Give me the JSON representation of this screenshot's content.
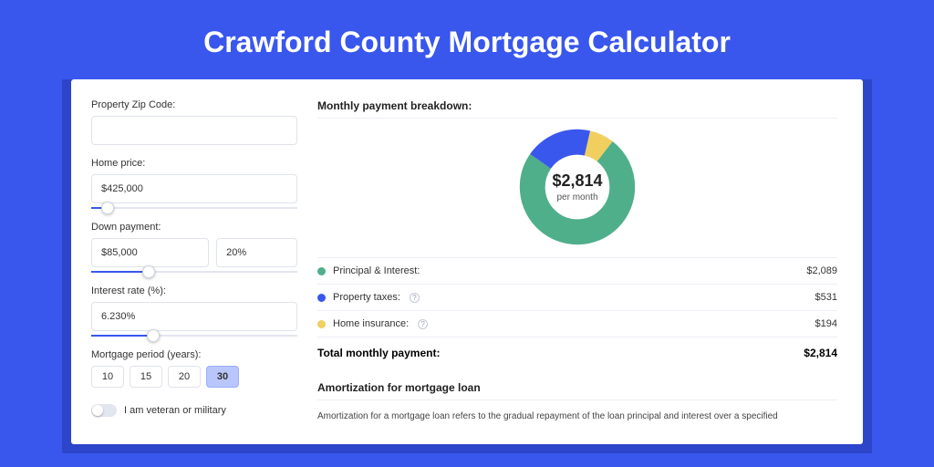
{
  "title": "Crawford County Mortgage Calculator",
  "left": {
    "zip_label": "Property Zip Code:",
    "zip_value": "",
    "price_label": "Home price:",
    "price_value": "$425,000",
    "price_fill_pct": 8,
    "down_label": "Down payment:",
    "down_value": "$85,000",
    "down_pct": "20%",
    "down_fill_pct": 28,
    "rate_label": "Interest rate (%):",
    "rate_value": "6.230%",
    "rate_fill_pct": 30,
    "period_label": "Mortgage period (years):",
    "periods": [
      "10",
      "15",
      "20",
      "30"
    ],
    "period_selected": "30",
    "vet_label": "I am veteran or military"
  },
  "breakdown": {
    "title": "Monthly payment breakdown:",
    "center_value": "$2,814",
    "center_sub": "per month",
    "items": [
      {
        "label": "Principal & Interest:",
        "value": "$2,089",
        "color": "#4faf8a",
        "tip": false
      },
      {
        "label": "Property taxes:",
        "value": "$531",
        "color": "#3957ed",
        "tip": true
      },
      {
        "label": "Home insurance:",
        "value": "$194",
        "color": "#f0cf5f",
        "tip": true
      }
    ],
    "total_label": "Total monthly payment:",
    "total_value": "$2,814"
  },
  "chart_data": {
    "type": "pie",
    "title": "Monthly payment breakdown",
    "series": [
      {
        "name": "Principal & Interest",
        "value": 2089,
        "color": "#4faf8a"
      },
      {
        "name": "Property taxes",
        "value": 531,
        "color": "#3957ed"
      },
      {
        "name": "Home insurance",
        "value": 194,
        "color": "#f0cf5f"
      }
    ],
    "total": 2814,
    "inner_radius_pct": 62
  },
  "amortization": {
    "title": "Amortization for mortgage loan",
    "body": "Amortization for a mortgage loan refers to the gradual repayment of the loan principal and interest over a specified"
  }
}
